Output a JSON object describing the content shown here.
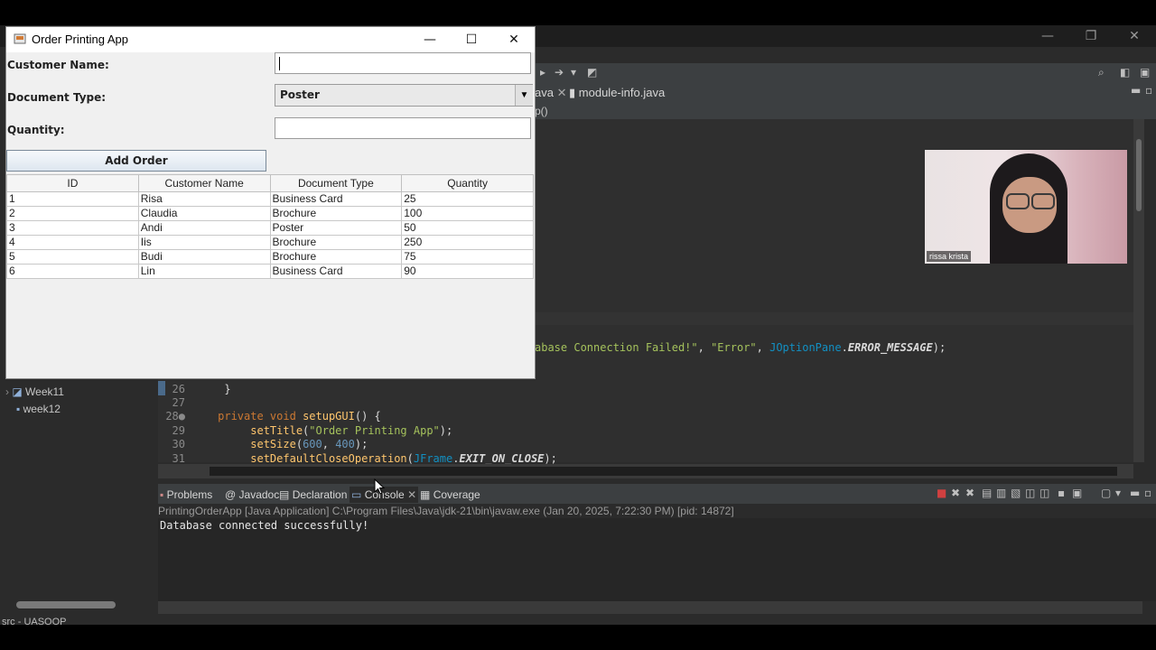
{
  "app_window": {
    "title": "Order Printing App",
    "controls": {
      "minimize": "—",
      "maximize": "☐",
      "close": "✕"
    },
    "form": {
      "customer_name_label": "Customer Name:",
      "customer_name_value": "",
      "document_type_label": "Document Type:",
      "document_type_value": "Poster",
      "quantity_label": "Quantity:",
      "quantity_value": "",
      "add_button_label": "Add Order"
    },
    "table": {
      "columns": [
        "ID",
        "Customer Name",
        "Document Type",
        "Quantity"
      ],
      "rows": [
        [
          "1",
          "Risa",
          "Business Card",
          "25"
        ],
        [
          "2",
          "Claudia",
          "Brochure",
          "100"
        ],
        [
          "3",
          "Andi",
          "Poster",
          "50"
        ],
        [
          "4",
          "Iis",
          "Brochure",
          "250"
        ],
        [
          "5",
          "Budi",
          "Brochure",
          "75"
        ],
        [
          "6",
          "Lin",
          "Business Card",
          "90"
        ]
      ]
    }
  },
  "ide": {
    "editor_tabs": [
      "ava",
      "module-info.java"
    ],
    "breadcrumb": "p()",
    "code_fragment": "abase Connection Failed!\", \"Error\", JOptionPane.ERROR_MESSAGE);",
    "code_lines": [
      {
        "num": "26",
        "text": "    }"
      },
      {
        "num": "27",
        "text": ""
      },
      {
        "num": "28",
        "text": "    private void setupGUI() {"
      },
      {
        "num": "29",
        "text": "        setTitle(\"Order Printing App\");"
      },
      {
        "num": "30",
        "text": "        setSize(600, 400);"
      },
      {
        "num": "31",
        "text": "        setDefaultCloseOperation(JFrame.EXIT_ON_CLOSE);"
      }
    ],
    "tree_items": [
      "Week11",
      "week12"
    ],
    "bottom_tabs": [
      "Problems",
      "Javadoc",
      "Declaration",
      "Console",
      "Coverage"
    ],
    "console_header": "PrintingOrderApp [Java Application] C:\\Program Files\\Java\\jdk-21\\bin\\javaw.exe  (Jan 20, 2025, 7:22:30 PM) [pid: 14872]",
    "console_output": "Database connected successfully!",
    "status": "src - UASOOP"
  },
  "webcam": {
    "name_label": "rissa krista"
  }
}
